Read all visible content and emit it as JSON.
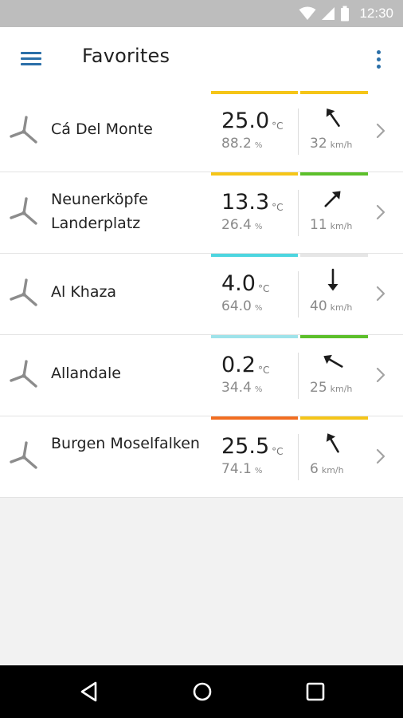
{
  "status_bar": {
    "time": "12:30"
  },
  "app_bar": {
    "title": "Favorites"
  },
  "favorites": [
    {
      "name": "Cá Del Monte",
      "temperature": "25.0",
      "temp_unit": "°C",
      "humidity": "88.2",
      "humidity_unit": "%",
      "wind_speed": "32",
      "wind_unit": "km/h",
      "wind_arrow_rotation_deg": -35,
      "temp_bar_color": "#f5c518",
      "wind_bar_color": "#f5c518"
    },
    {
      "name": "Neunerköpfe Landerplatz",
      "temperature": "13.3",
      "temp_unit": "°C",
      "humidity": "26.4",
      "humidity_unit": "%",
      "wind_speed": "11",
      "wind_unit": "km/h",
      "wind_arrow_rotation_deg": 45,
      "temp_bar_color": "#f5c518",
      "wind_bar_color": "#5cbf2a"
    },
    {
      "name": "Al Khaza",
      "temperature": "4.0",
      "temp_unit": "°C",
      "humidity": "64.0",
      "humidity_unit": "%",
      "wind_speed": "40",
      "wind_unit": "km/h",
      "wind_arrow_rotation_deg": 180,
      "temp_bar_color": "#4dd6e0",
      "wind_bar_color": "#e6e6e6"
    },
    {
      "name": "Allandale",
      "temperature": "0.2",
      "temp_unit": "°C",
      "humidity": "34.4",
      "humidity_unit": "%",
      "wind_speed": "25",
      "wind_unit": "km/h",
      "wind_arrow_rotation_deg": -60,
      "temp_bar_color": "#9ee3ea",
      "wind_bar_color": "#5cbf2a"
    },
    {
      "name": "Burgen Moselfalken",
      "temperature": "25.5",
      "temp_unit": "°C",
      "humidity": "74.1",
      "humidity_unit": "%",
      "wind_speed": "6",
      "wind_unit": "km/h",
      "wind_arrow_rotation_deg": -30,
      "temp_bar_color": "#f26d21",
      "wind_bar_color": "#f5c518"
    }
  ],
  "icons": {
    "menu": "hamburger-menu-icon",
    "overflow": "more-vert-icon",
    "location": "wind-turbine-icon",
    "wind": "wind-direction-arrow-icon",
    "chevron": "chevron-right-icon",
    "nav": [
      "back-icon",
      "home-icon",
      "recents-icon"
    ]
  },
  "colors": {
    "accent": "#2a6fa8",
    "status_bar": "#bdbdbd",
    "nav_bar": "#000000"
  }
}
